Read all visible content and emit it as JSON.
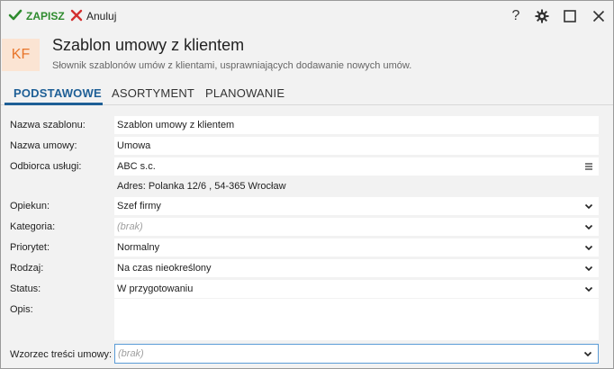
{
  "toolbar": {
    "save_label": "ZAPISZ",
    "cancel_label": "Anuluj"
  },
  "window_controls": {
    "help_glyph": "?",
    "icons": [
      "help-icon",
      "gear-icon",
      "maximize-icon",
      "close-icon"
    ]
  },
  "header": {
    "avatar_initials": "KF",
    "title": "Szablon umowy z klientem",
    "subtitle": "Słownik szablonów umów z klientami, usprawniających dodawanie nowych umów."
  },
  "tabs": [
    {
      "label": "PODSTAWOWE",
      "active": true
    },
    {
      "label": "ASORTYMENT",
      "active": false
    },
    {
      "label": "PLANOWANIE",
      "active": false
    }
  ],
  "form": {
    "nazwa_szablonu": {
      "label": "Nazwa szablonu:",
      "value": "Szablon umowy z klientem"
    },
    "nazwa_umowy": {
      "label": "Nazwa umowy:",
      "value": "Umowa"
    },
    "odbiorca": {
      "label": "Odbiorca usługi:",
      "value": "ABC s.c.",
      "address": "Adres:  Polanka  12/6 , 54-365 Wrocław"
    },
    "opiekun": {
      "label": "Opiekun:",
      "value": "Szef firmy"
    },
    "kategoria": {
      "label": "Kategoria:",
      "placeholder": "(brak)"
    },
    "priorytet": {
      "label": "Priorytet:",
      "value": "Normalny"
    },
    "rodzaj": {
      "label": "Rodzaj:",
      "value": "Na czas nieokreślony"
    },
    "status": {
      "label": "Status:",
      "value": "W przygotowaniu"
    },
    "opis": {
      "label": "Opis:",
      "value": ""
    },
    "wzorzec": {
      "label": "Wzorzec treści umowy:",
      "placeholder": "(brak)"
    }
  },
  "colors": {
    "accent": "#1e5f96",
    "save_green": "#2e8b2e",
    "cancel_red": "#d32f2f",
    "avatar_bg": "#fbe4d3",
    "avatar_text": "#e8752a"
  }
}
